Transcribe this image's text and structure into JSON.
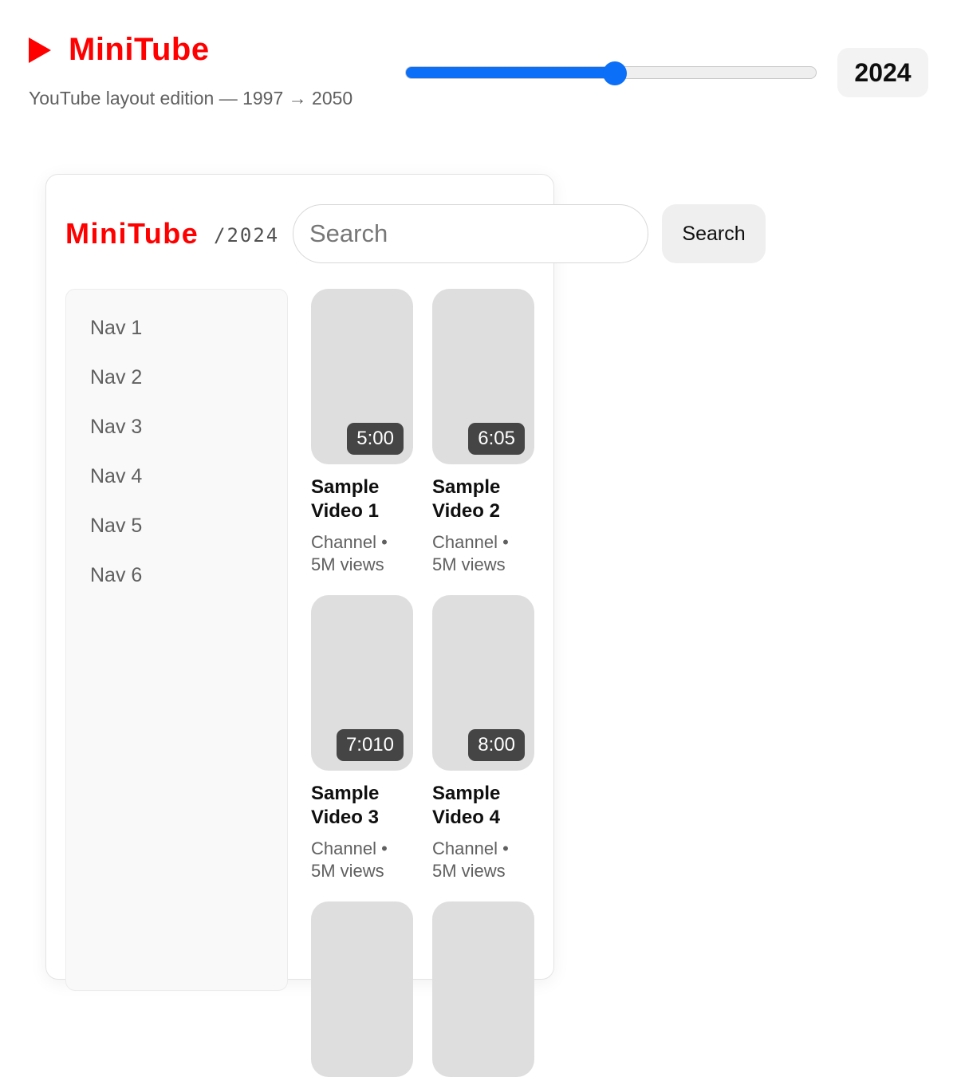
{
  "header": {
    "title": "MiniTube",
    "subtitle": "YouTube layout edition — 1997 → 2050",
    "year_slider": {
      "min": 1997,
      "max": 2050,
      "value": 2024
    },
    "year_display": "2024"
  },
  "app": {
    "logo": "MiniTube",
    "year_tag": "/2024",
    "search": {
      "placeholder": "Search",
      "value": "",
      "button_label": "Search"
    },
    "nav": [
      "Nav 1",
      "Nav 2",
      "Nav 3",
      "Nav 4",
      "Nav 5",
      "Nav 6"
    ],
    "videos": [
      {
        "title": "Sample Video 1",
        "meta": "Channel • 5M views",
        "duration": "5:00"
      },
      {
        "title": "Sample Video 2",
        "meta": "Channel • 5M views",
        "duration": "6:05"
      },
      {
        "title": "Sample Video 3",
        "meta": "Channel • 5M views",
        "duration": "7:010"
      },
      {
        "title": "Sample Video 4",
        "meta": "Channel • 5M views",
        "duration": "8:00"
      }
    ]
  },
  "colors": {
    "brand": "#ff0000",
    "accent": "#0b6ff7",
    "thumbnail": "#dedede"
  },
  "icons": {
    "brand": "play-icon"
  }
}
